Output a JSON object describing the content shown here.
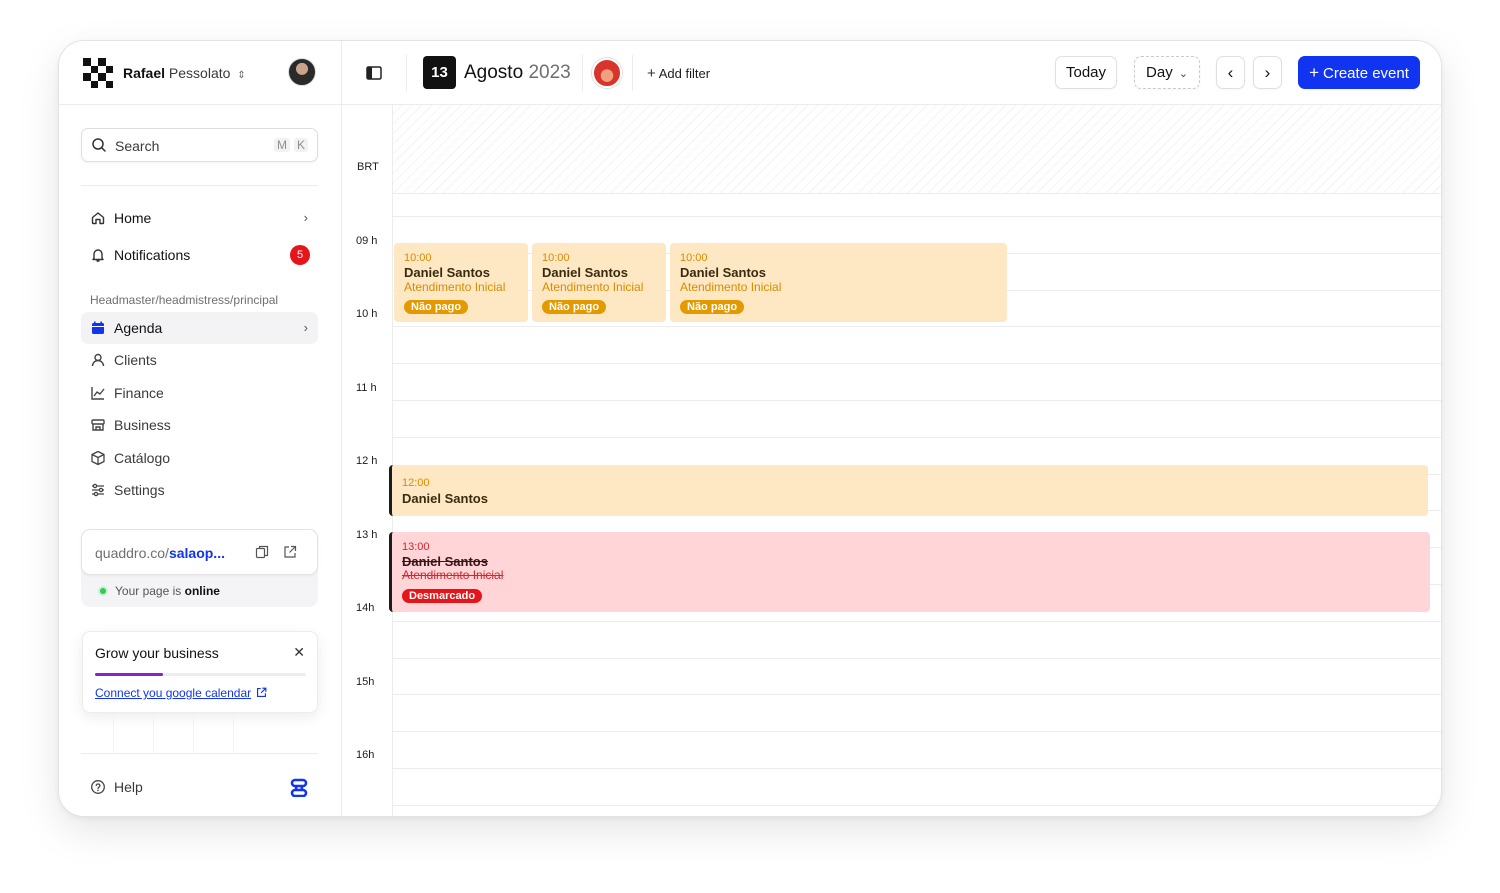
{
  "user": {
    "first_name": "Rafael",
    "last_name": "Pessolato"
  },
  "search": {
    "placeholder": "Search",
    "shortcut_1": "M",
    "shortcut_2": "K"
  },
  "nav_top": [
    {
      "label": "Home",
      "icon": "home-icon"
    },
    {
      "label": "Notifications",
      "icon": "bell-icon",
      "badge": "5"
    }
  ],
  "section_label": "Headmaster/headmistress/principal",
  "nav_main": [
    {
      "label": "Agenda",
      "icon": "calendar-icon"
    },
    {
      "label": "Clients",
      "icon": "user-icon"
    },
    {
      "label": "Finance",
      "icon": "chart-icon"
    },
    {
      "label": "Business",
      "icon": "store-icon"
    },
    {
      "label": "Catálogo",
      "icon": "box-icon"
    },
    {
      "label": "Settings",
      "icon": "sliders-icon"
    }
  ],
  "page_card": {
    "url_prefix": "quaddro.co/",
    "url_slug": "salaop...",
    "status_prefix": "Your page is ",
    "status_value": "online"
  },
  "grow": {
    "title": "Grow your business",
    "progress": 0.32,
    "link": "Connect you google calendar"
  },
  "help": {
    "label": "Help"
  },
  "topbar": {
    "day": "13",
    "month": "Agosto",
    "year": "2023",
    "add_filter": "Add filter",
    "today": "Today",
    "view": "Day",
    "create": "Create event"
  },
  "calendar": {
    "timezone": "BRT",
    "hours": [
      "09 h",
      "10 h",
      "11 h",
      "12 h",
      "13 h",
      "14h",
      "15h",
      "16h"
    ],
    "events": [
      {
        "time": "10:00",
        "name": "Daniel Santos",
        "service": "Atendimento Inicial",
        "tag": "Não pago"
      },
      {
        "time": "10:00",
        "name": "Daniel Santos",
        "service": "Atendimento Inicial",
        "tag": "Não pago"
      },
      {
        "time": "10:00",
        "name": "Daniel Santos",
        "service": "Atendimento Inicial",
        "tag": "Não pago"
      },
      {
        "time": "12:00",
        "name": "Daniel Santos"
      },
      {
        "time": "13:00",
        "name": "Daniel Santos",
        "service": "Atendimento Inicial",
        "tag": "Desmarcado"
      }
    ]
  },
  "colors": {
    "accent": "#1034f0",
    "danger": "#e5151a",
    "event_orange": "#fde8c3",
    "event_red": "#ffd5d8",
    "progress": "#8a1fd6"
  }
}
